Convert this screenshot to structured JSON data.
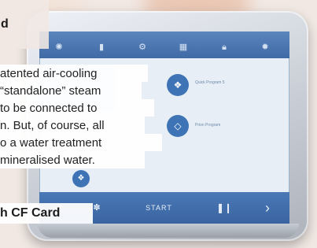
{
  "device": {
    "status_left": "",
    "program_title": "",
    "side_label": "",
    "quick_program_label": "Quick Program 5",
    "prion_program_label": "Prion Program",
    "start_label": "START",
    "tab_icons": [
      "settings-icon",
      "document-icon",
      "gear-icon",
      "calendar-icon",
      "lock-icon",
      "cog-icon"
    ]
  },
  "overlay": {
    "heading_fragment": "d",
    "body_lines": [
      "atented air-cooling",
      "“standalone” steam",
      "to be connected to",
      "n. But, of course, all",
      "o a water treatment",
      "mineralised water."
    ],
    "subheading": "h CF Card"
  },
  "colors": {
    "screen_blue": "#3f6aa5",
    "accent_blue": "#3e74b6",
    "device_silver": "#c9ced6",
    "background": "#f1e8e3"
  }
}
